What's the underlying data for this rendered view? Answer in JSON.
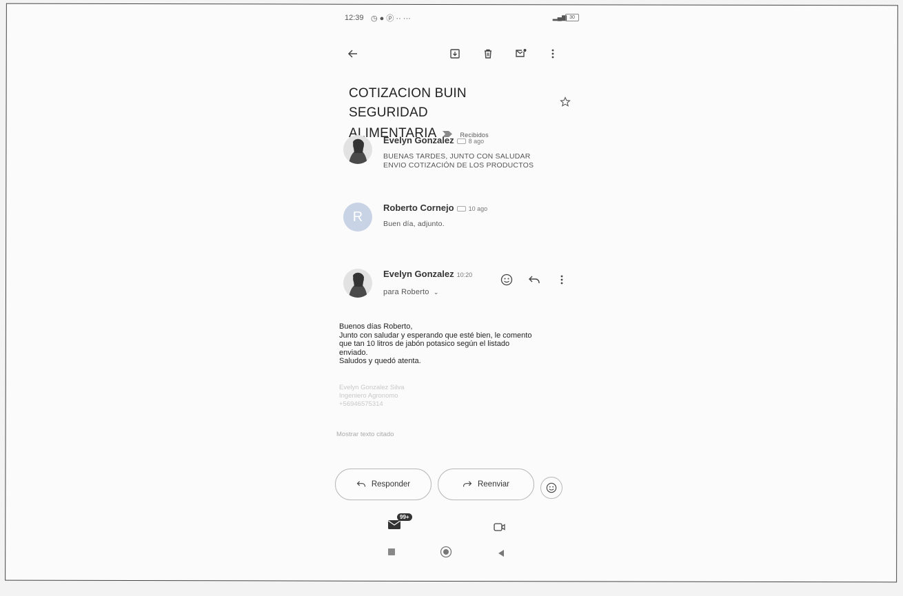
{
  "status_bar": {
    "time": "12:39",
    "battery": "30"
  },
  "subject": {
    "line1": "COTIZACION BUIN SEGURIDAD",
    "line2": "ALIMENTARIA",
    "label": "Recibidos"
  },
  "messages": [
    {
      "sender": "Evelyn Gonzalez",
      "date": "8 ago",
      "snippet_line1": "BUENAS TARDES, JUNTO CON SALUDAR",
      "snippet_line2": "ENVIO COTIZACIÓN DE LOS PRODUCTOS"
    },
    {
      "sender": "Roberto Cornejo",
      "date": "10 ago",
      "snippet_line1": "Buen día, adjunto.",
      "avatar_initial": "R"
    },
    {
      "sender": "Evelyn Gonzalez",
      "date": "10:20",
      "recipient": "para Roberto"
    }
  ],
  "body": {
    "lines": [
      "Buenos días Roberto,",
      "Junto con saludar y esperando que esté bien, le comento",
      "que tan 10 litros de jabón potasico según el listado",
      "enviado.",
      "Saludos y quedó atenta."
    ],
    "signature": [
      "Evelyn Gonzalez Silva",
      "Ingeniero Agronomo",
      "+56946575314"
    ],
    "show_quoted": "Mostrar texto citado"
  },
  "buttons": {
    "reply": "Responder",
    "forward": "Reenviar"
  },
  "nav": {
    "mail_badge": "99+"
  },
  "colors": {
    "avatar_r": "#c8d3e6",
    "text": "#222222"
  }
}
